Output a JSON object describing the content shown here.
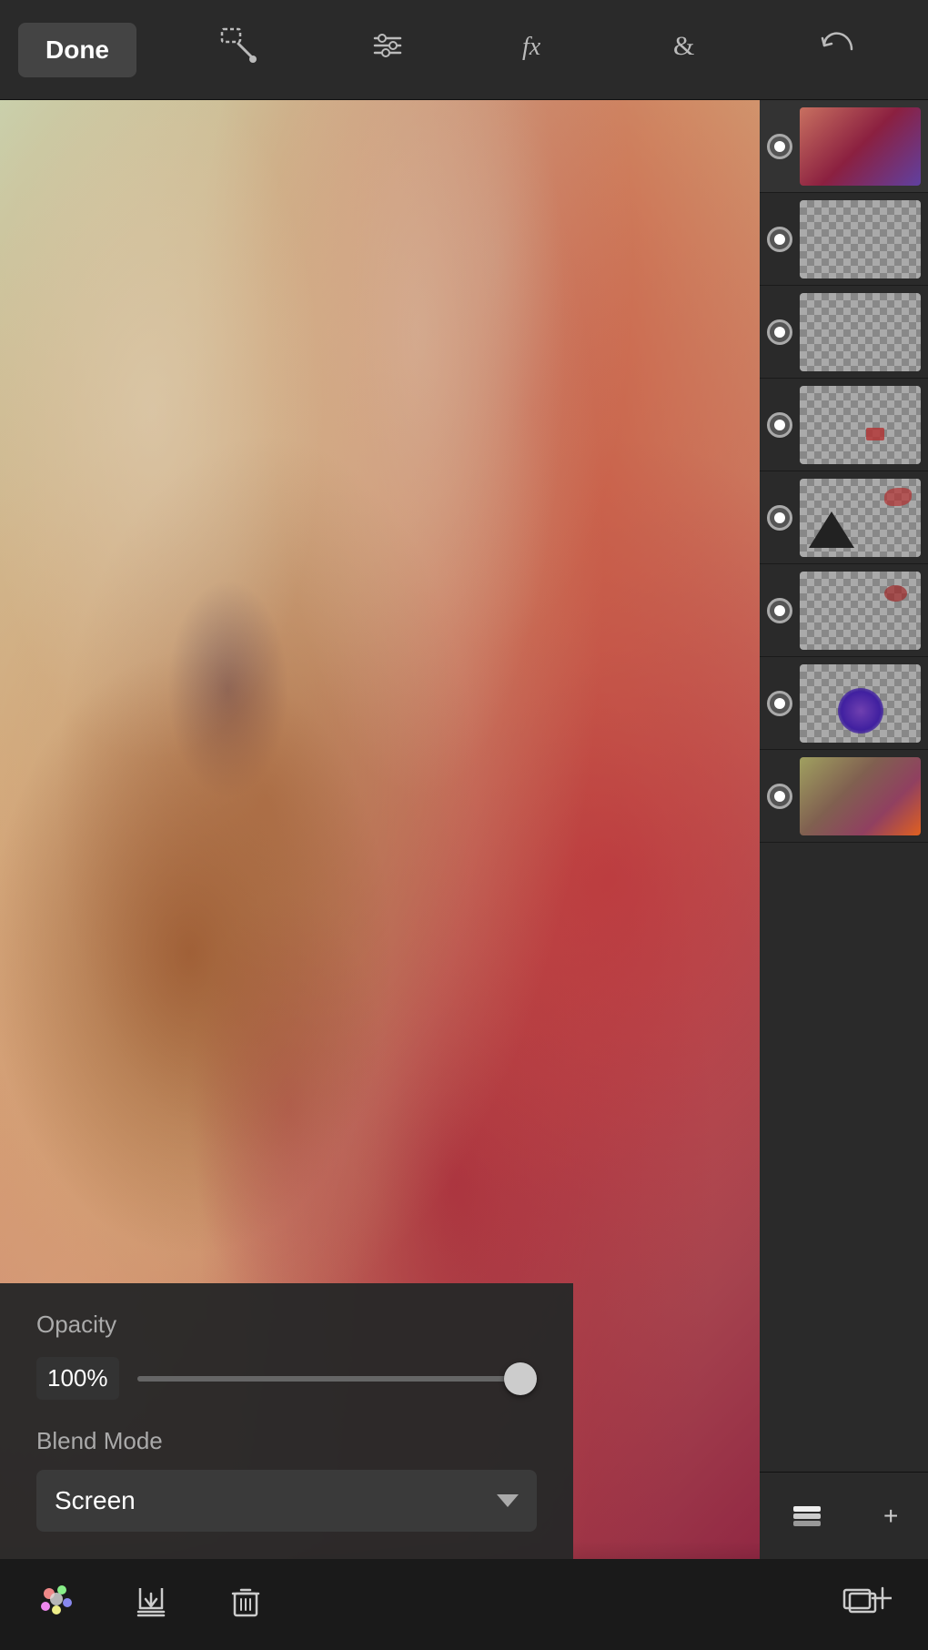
{
  "toolbar": {
    "done_label": "Done",
    "icons": [
      {
        "name": "selection-tool-icon",
        "label": "Selection Tool"
      },
      {
        "name": "adjustments-icon",
        "label": "Adjustments"
      },
      {
        "name": "effects-icon",
        "label": "FX"
      },
      {
        "name": "blend-icon",
        "label": "Blend"
      },
      {
        "name": "undo-icon",
        "label": "Undo"
      }
    ]
  },
  "layers": [
    {
      "id": 1,
      "type": "composite",
      "active": true
    },
    {
      "id": 2,
      "type": "transparent"
    },
    {
      "id": 3,
      "type": "transparent"
    },
    {
      "id": 4,
      "type": "transparent_mark"
    },
    {
      "id": 5,
      "type": "triangle_splash"
    },
    {
      "id": 6,
      "type": "splatter"
    },
    {
      "id": 7,
      "type": "flower"
    },
    {
      "id": 8,
      "type": "colorful"
    }
  ],
  "layer_controls": {
    "layers_icon": "layers-icon",
    "add_label": "+"
  },
  "opacity_panel": {
    "label": "Opacity",
    "value": "100%",
    "slider_percent": 97
  },
  "blend_panel": {
    "label": "Blend Mode",
    "value": "Screen"
  },
  "bottom_bar": {
    "paint_icon": "paint-icon",
    "download_icon": "download-layers-icon",
    "trash_icon": "trash-icon",
    "add_layer_icon": "add-layer-icon"
  }
}
